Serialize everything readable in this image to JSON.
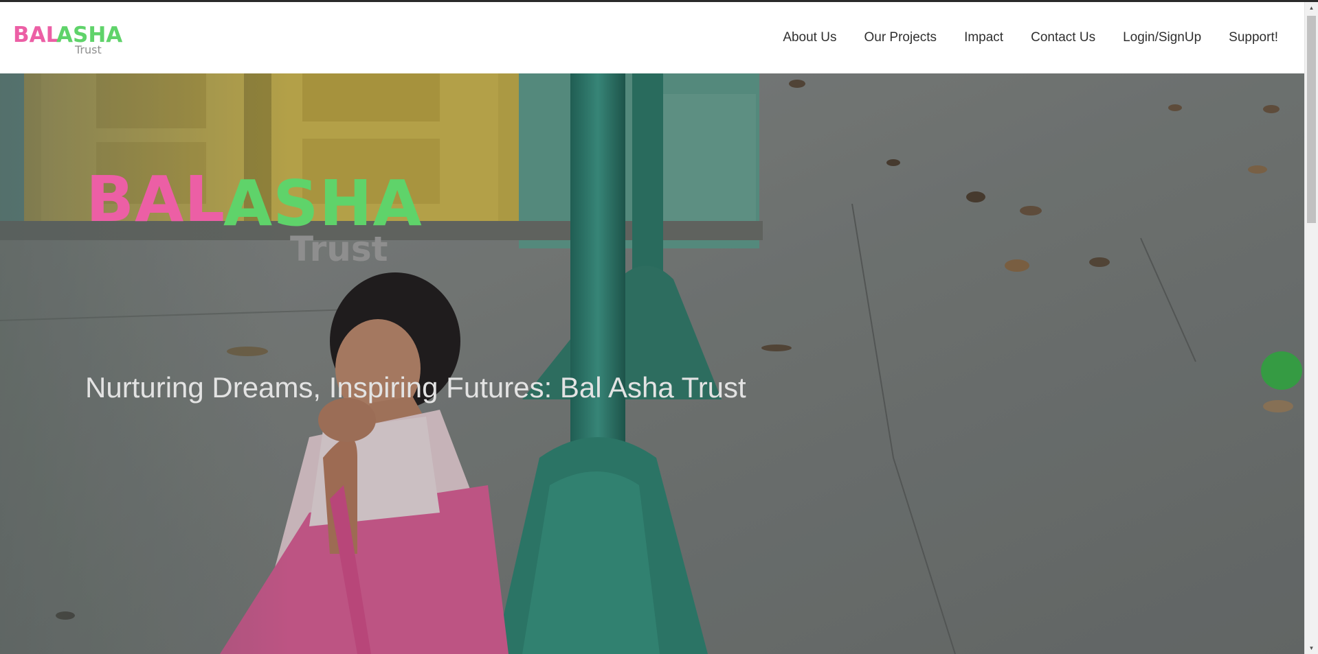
{
  "colors": {
    "brand_pink": "#ec5fa5",
    "brand_green": "#5fd36a",
    "trust_gray": "#8f8f8f",
    "nav_text": "#2f2f2f",
    "tagline_text": "#e3e3e3"
  },
  "header": {
    "logo": {
      "word_bal": "BAL",
      "word_asha": "ASHA",
      "word_trust": "Trust"
    },
    "nav": [
      {
        "label": "About Us"
      },
      {
        "label": "Our Projects"
      },
      {
        "label": "Impact"
      },
      {
        "label": "Contact Us"
      },
      {
        "label": "Login/SignUp"
      },
      {
        "label": "Support!"
      }
    ]
  },
  "hero": {
    "logo": {
      "word_bal": "BAL",
      "word_asha": "ASHA",
      "word_trust": "Trust"
    },
    "tagline": "Nurturing Dreams, Inspiring Futures: Bal Asha Trust",
    "background_description_icon": "photo-child-by-green-pillar"
  },
  "scrollbar": {
    "up_icon": "scroll-up-arrow-icon",
    "down_icon": "scroll-down-arrow-icon"
  }
}
